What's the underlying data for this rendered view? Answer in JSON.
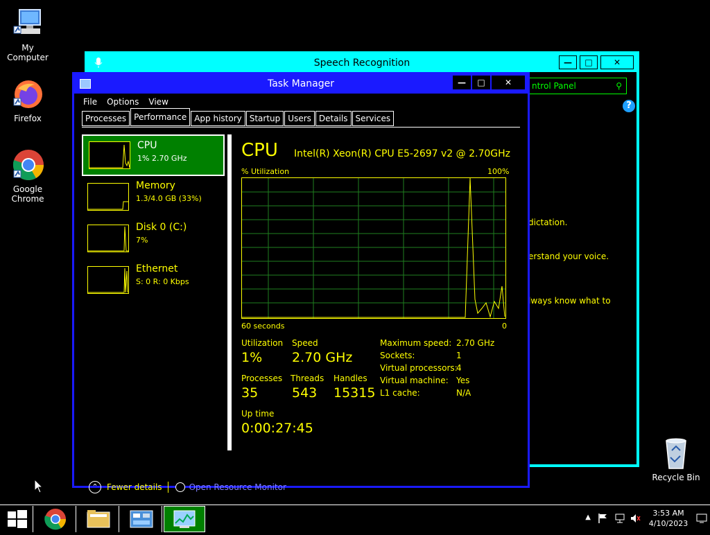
{
  "desktop": {
    "icons": [
      {
        "label": "My Computer"
      },
      {
        "label": "Firefox"
      },
      {
        "label": "Google Chrome"
      },
      {
        "label": "Recycle Bin"
      }
    ]
  },
  "speech": {
    "title": "Speech Recognition",
    "search_text": "ntrol Panel",
    "help": "?",
    "lines": [
      "dictation.",
      "erstand your voice.",
      "lways know what to"
    ]
  },
  "taskmgr": {
    "title": "Task Manager",
    "menu": [
      "File",
      "Options",
      "View"
    ],
    "tabs": [
      "Processes",
      "Performance",
      "App history",
      "Startup",
      "Users",
      "Details",
      "Services"
    ],
    "active_tab": "Performance",
    "sidebar": [
      {
        "name": "CPU",
        "sub": "1% 2.70 GHz"
      },
      {
        "name": "Memory",
        "sub": "1.3/4.0 GB (33%)"
      },
      {
        "name": "Disk 0 (C:)",
        "sub": "7%"
      },
      {
        "name": "Ethernet",
        "sub": "S: 0 R: 0 Kbps"
      }
    ],
    "cpu": {
      "heading": "CPU",
      "model": "Intel(R) Xeon(R) CPU E5-2697 v2 @ 2.70GHz",
      "util_label": "% Utilization",
      "max_label": "100%",
      "time_label": "60 seconds",
      "zero_label": "0",
      "utilization_label": "Utilization",
      "utilization": "1%",
      "speed_label": "Speed",
      "speed": "2.70 GHz",
      "processes_label": "Processes",
      "processes": "35",
      "threads_label": "Threads",
      "threads": "543",
      "handles_label": "Handles",
      "handles": "15315",
      "uptime_label": "Up time",
      "uptime": "0:00:27:45",
      "details": [
        {
          "k": "Maximum speed:",
          "v": "2.70 GHz"
        },
        {
          "k": "Sockets:",
          "v": "1"
        },
        {
          "k": "Virtual processors:",
          "v": "4"
        },
        {
          "k": "Virtual machine:",
          "v": "Yes"
        },
        {
          "k": "L1 cache:",
          "v": "N/A"
        }
      ]
    },
    "footer": {
      "fewer": "Fewer details",
      "resmon": "Open Resource Monitor"
    }
  },
  "taskbar": {
    "time": "3:53 AM",
    "date": "4/10/2023"
  },
  "colors": {
    "hc_yellow": "#ffff00",
    "hc_green": "#008000",
    "hc_cyan": "#00ffff",
    "hc_blue": "#1a1aff",
    "graph_grid": "#1f7f1f"
  }
}
